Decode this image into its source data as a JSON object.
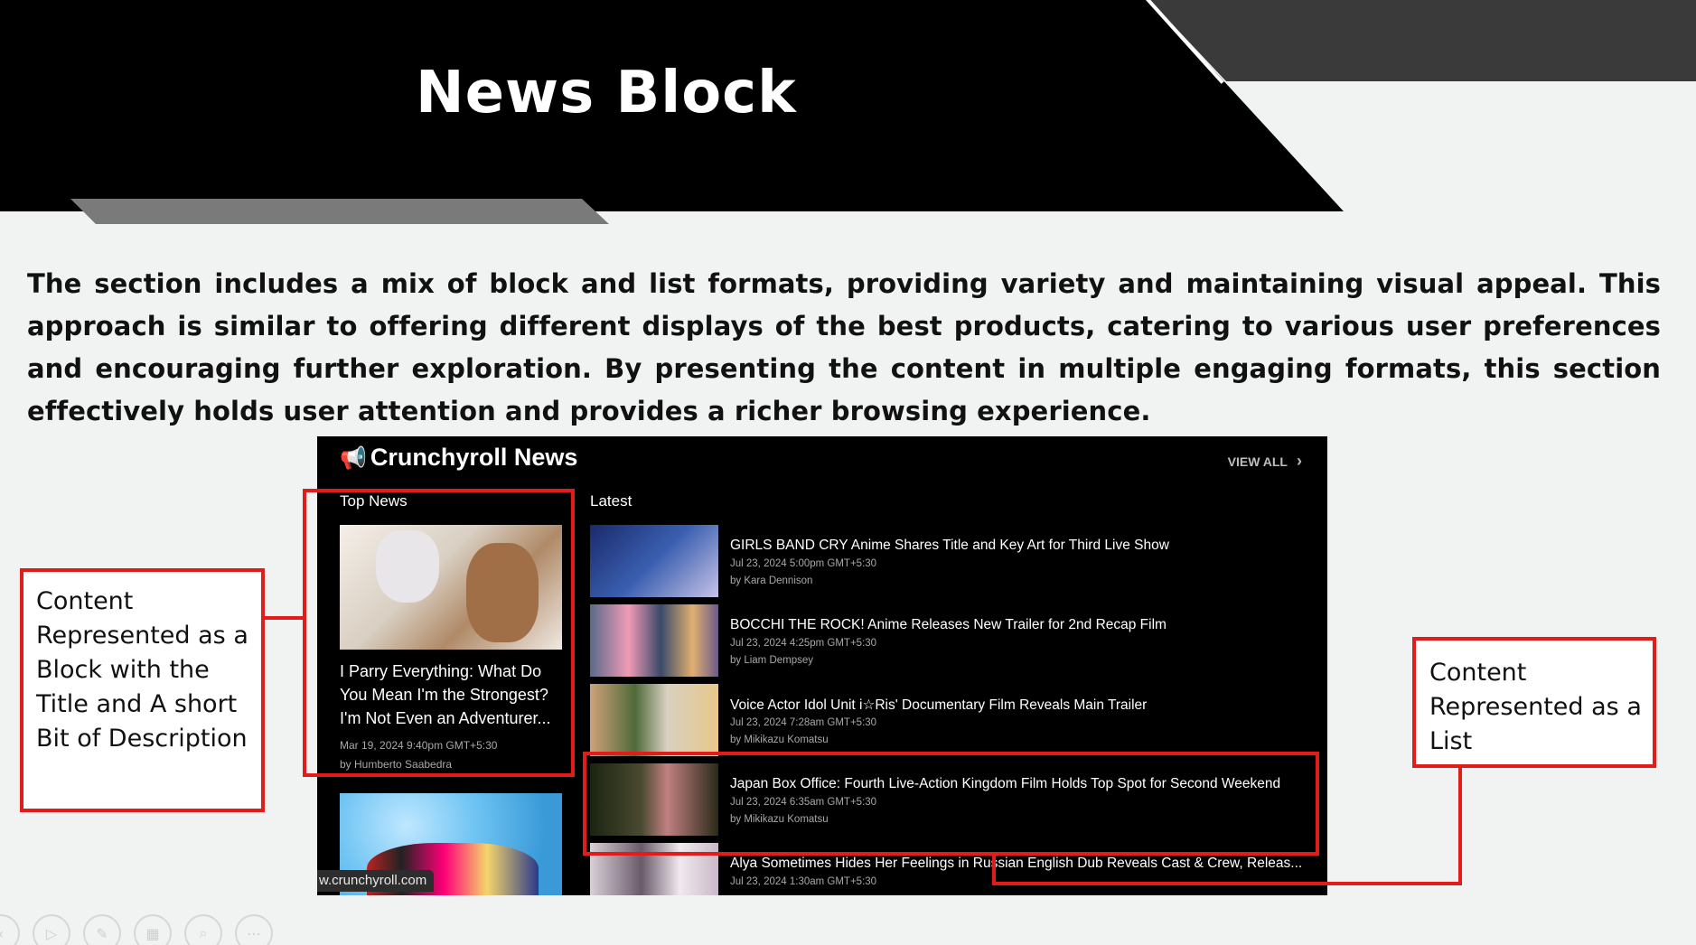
{
  "slide": {
    "title": "News Block",
    "description": "The section includes a mix of block and list formats, providing variety and maintaining visual appeal. This approach is similar to offering different displays of the best products, catering to various user preferences and encouraging further exploration. By presenting the content in multiple engaging formats, this section effectively holds user attention and provides a richer browsing experience."
  },
  "crunchyroll": {
    "brand_icon": "megaphone-icon",
    "brand_name": "Crunchyroll News",
    "view_all": "VIEW ALL",
    "top_news_label": "Top News",
    "latest_label": "Latest",
    "url_badge": "w.crunchyroll.com",
    "featured": {
      "title": "I Parry Everything: What Do You Mean I'm the Strongest? I'm Not Even an Adventurer...",
      "date": "Mar 19, 2024 9:40pm GMT+5:30",
      "author": "by Humberto Saabedra"
    },
    "latest": [
      {
        "title": "GIRLS BAND CRY Anime Shares Title and Key Art for Third Live Show",
        "date": "Jul 23, 2024 5:00pm GMT+5:30",
        "author": "by Kara Dennison"
      },
      {
        "title": "BOCCHI THE ROCK! Anime Releases New Trailer for 2nd Recap Film",
        "date": "Jul 23, 2024 4:25pm GMT+5:30",
        "author": "by Liam Dempsey"
      },
      {
        "title": "Voice Actor Idol Unit i☆Ris' Documentary Film Reveals Main Trailer",
        "date": "Jul 23, 2024 7:28am GMT+5:30",
        "author": "by Mikikazu Komatsu"
      },
      {
        "title": "Japan Box Office: Fourth Live-Action Kingdom Film Holds Top Spot for Second Weekend",
        "date": "Jul 23, 2024 6:35am GMT+5:30",
        "author": "by Mikikazu Komatsu"
      },
      {
        "title": "Alya Sometimes Hides Her Feelings in Russian English Dub Reveals Cast & Crew, Releas...",
        "date": "Jul 23, 2024 1:30am GMT+5:30",
        "author": ""
      }
    ]
  },
  "callouts": {
    "block": "Content Represented as a Block with the Title and A short Bit of Description",
    "list": "Content Represented as a List"
  },
  "colors": {
    "accent_red": "#e21b1b",
    "header_black": "#000000",
    "background": "#f1f2f2"
  },
  "toolbar_icons": [
    "prev-icon",
    "next-icon",
    "pen-icon",
    "grid-icon",
    "zoom-icon",
    "more-icon"
  ]
}
